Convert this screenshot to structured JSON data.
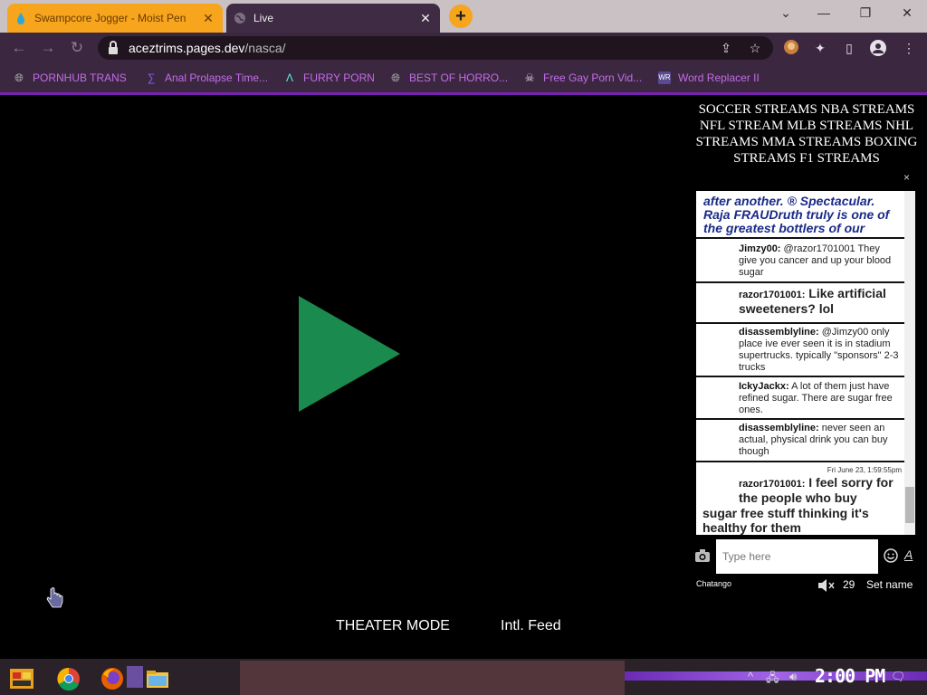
{
  "browser": {
    "tabs": [
      {
        "title": "Swampcore Jogger - Moist Pen",
        "active": false
      },
      {
        "title": "Live",
        "active": true
      }
    ],
    "new_tab": "+",
    "window": {
      "minimize": "—",
      "restore": "❐",
      "close": "✕"
    },
    "url_host": "aceztrims.pages.dev",
    "url_path": "/nasca/",
    "bookmarks": [
      {
        "label": "PORNHUB TRANS",
        "icon": "globe-icon"
      },
      {
        "label": "Anal Prolapse Time...",
        "icon": "bracket-icon"
      },
      {
        "label": "FURRY PORN",
        "icon": "a-logo-icon"
      },
      {
        "label": "BEST OF HORRO...",
        "icon": "globe-icon"
      },
      {
        "label": "Free Gay Porn Vid...",
        "icon": "skull-icon"
      },
      {
        "label": "Word Replacer II",
        "icon": "wr-icon"
      }
    ]
  },
  "player": {
    "theater_mode": "THEATER MODE",
    "intl_feed": "Intl. Feed",
    "play_color": "#1a8a4e"
  },
  "streams_header": "SOCCER STREAMS NBA STREAMS NFL STREAM MLB STREAMS NHL STREAMS MMA STREAMS BOXING STREAMS F1 STREAMS",
  "chat": {
    "close": "×",
    "first_message": "after another. ® Spectacular. Raja FRAUDruth truly is one of the greatest bottlers of our generation.",
    "messages": [
      {
        "user": "Jimzy00:",
        "text": " @razor1701001 They give you cancer and up your blood sugar"
      },
      {
        "user": "razor1701001:",
        "text": " Like artificial sweeteners? lol"
      },
      {
        "user": "disassemblyline:",
        "text": " @Jimzy00 only place ive ever seen it is in stadium supertrucks. typically \"sponsors\" 2-3 trucks"
      },
      {
        "user": "IckyJackx:",
        "text": " A lot of them just have refined sugar. There are sugar free ones."
      },
      {
        "user": "disassemblyline:",
        "text": " never seen an actual, physical drink you can buy though"
      },
      {
        "timestamp": "Fri June 23, 1:59:55pm",
        "user": "razor1701001:",
        "text_a": " I feel sorry for the people who buy",
        "text_b": "sugar free stuff thinking it's healthy for them"
      }
    ],
    "input_placeholder": "Type here",
    "font_button": "A",
    "branding": "Chatango",
    "user_count": "29",
    "set_name": "Set name"
  },
  "taskbar": {
    "clock": "2:00 PM"
  }
}
